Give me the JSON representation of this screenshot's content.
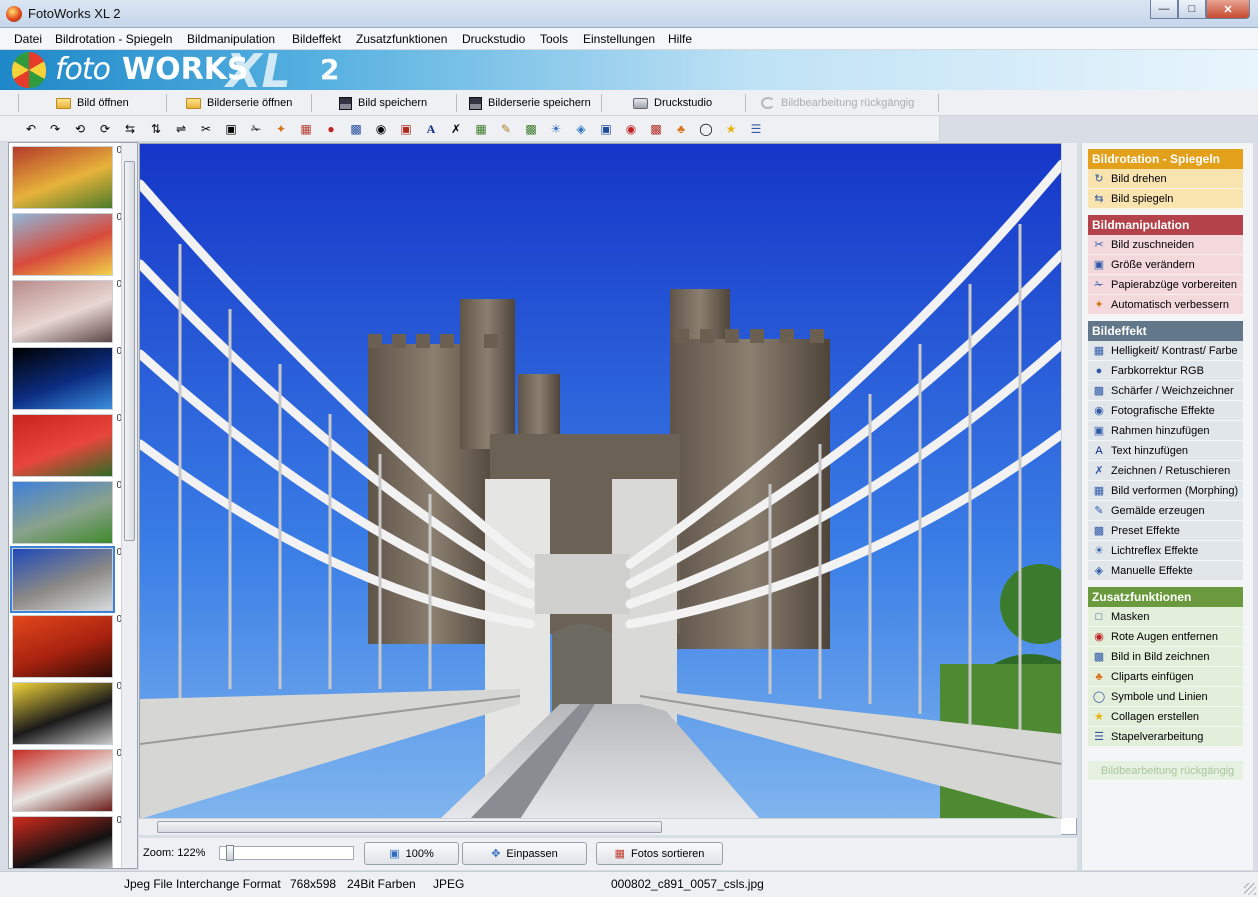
{
  "window": {
    "title": "FotoWorks XL 2"
  },
  "menu": [
    "Datei",
    "Bildrotation - Spiegeln",
    "Bildmanipulation",
    "Bildeffekt",
    "Zusatzfunktionen",
    "Druckstudio",
    "Tools",
    "Einstellungen",
    "Hilfe"
  ],
  "banner": {
    "logo_foto": "foto",
    "logo_works": "WORKS",
    "logo_xl": "XL",
    "logo_version": "2"
  },
  "toolbar": {
    "open_image": "Bild öffnen",
    "open_series": "Bilderserie öffnen",
    "save_image": "Bild speichern",
    "save_series": "Bilderserie speichern",
    "print_studio": "Druckstudio",
    "undo": "Bildbearbeitung rückgängig"
  },
  "tool_icons": [
    "rotate-left-icon",
    "rotate-right-icon",
    "rotate-ccw-icon",
    "rotate-cw-icon",
    "flip-horizontal-icon",
    "flip-vertical-icon",
    "flip-icon",
    "scissors-icon",
    "resize-icon",
    "crop-icon",
    "magic-wand-icon",
    "levels-icon",
    "rgb-icon",
    "sharpen-icon",
    "camera-icon",
    "frame-icon",
    "text-icon",
    "draw-icon",
    "morph-icon",
    "paint-icon",
    "preset-icon",
    "lens-flare-icon",
    "manual-effect-icon",
    "square-icon",
    "red-eye-icon",
    "picture-in-picture-icon",
    "clipart-icon",
    "symbols-icon",
    "star-icon",
    "batch-icon"
  ],
  "thumbnails": [
    {
      "name": "fruits",
      "index": "0",
      "colors": [
        "#b43a2b",
        "#e7b33b",
        "#4c7a2a"
      ]
    },
    {
      "name": "paints",
      "index": "0",
      "colors": [
        "#8fb7d9",
        "#d84a3b",
        "#f1d34a"
      ]
    },
    {
      "name": "conference-room",
      "index": "0",
      "colors": [
        "#b88b8b",
        "#e8d7d2",
        "#5a4545"
      ]
    },
    {
      "name": "earth-moon",
      "index": "0",
      "colors": [
        "#000000",
        "#0b2c80",
        "#3b8ee0"
      ]
    },
    {
      "name": "strawberries",
      "index": "0",
      "colors": [
        "#c8241f",
        "#e8463c",
        "#2c6b25"
      ]
    },
    {
      "name": "castle-blue",
      "index": "0",
      "colors": [
        "#3f7fd8",
        "#8aa28d",
        "#3e8a2c"
      ]
    },
    {
      "name": "bridge-castle",
      "index": "0",
      "colors": [
        "#1f49b8",
        "#8c8a86",
        "#d8dadd"
      ],
      "selected": true
    },
    {
      "name": "airplane-sunset",
      "index": "0",
      "colors": [
        "#e2481c",
        "#a7220f",
        "#2b0c07"
      ]
    },
    {
      "name": "yellow-car",
      "index": "0",
      "colors": [
        "#f0d33a",
        "#1a1a1a",
        "#c9c9c9"
      ]
    },
    {
      "name": "car-interior",
      "index": "0",
      "colors": [
        "#c62b23",
        "#e9e6e3",
        "#6b1b17"
      ]
    },
    {
      "name": "red-car",
      "index": "0",
      "colors": [
        "#d22a1e",
        "#111111",
        "#e9e9e9"
      ]
    }
  ],
  "zoom": {
    "label": "Zoom: 122%",
    "level_fraction": 0.05
  },
  "buttons": {
    "zoom100": "100%",
    "fit": "Einpassen",
    "sort": "Fotos sortieren"
  },
  "side_panel": {
    "sections": [
      {
        "title": "Bildrotation - Spiegeln",
        "header_color": "#e3a01b",
        "item_color": "#f9e4b0",
        "items": [
          {
            "label": "Bild drehen",
            "icon": "rotate-image-icon"
          },
          {
            "label": "Bild spiegeln",
            "icon": "mirror-image-icon"
          }
        ]
      },
      {
        "title": "Bildmanipulation",
        "header_color": "#b3424a",
        "item_color": "#f3d9dc",
        "items": [
          {
            "label": "Bild zuschneiden",
            "icon": "scissors-icon"
          },
          {
            "label": "Größe verändern",
            "icon": "resize-icon"
          },
          {
            "label": "Papierabzüge vorbereiten",
            "icon": "print-crop-icon"
          },
          {
            "label": "Automatisch verbessern",
            "icon": "magic-wand-icon"
          }
        ]
      },
      {
        "title": "Bildeffekt",
        "header_color": "#62778a",
        "item_color": "#e1e6eb",
        "items": [
          {
            "label": "Helligkeit/ Kontrast/ Farbe",
            "icon": "levels-icon"
          },
          {
            "label": "Farbkorrektur RGB",
            "icon": "rgb-icon"
          },
          {
            "label": "Schärfer / Weichzeichner",
            "icon": "sharpen-icon"
          },
          {
            "label": "Fotografische Effekte",
            "icon": "camera-icon"
          },
          {
            "label": "Rahmen hinzufügen",
            "icon": "frame-icon"
          },
          {
            "label": "Text hinzufügen",
            "icon": "text-icon"
          },
          {
            "label": "Zeichnen / Retuschieren",
            "icon": "draw-icon"
          },
          {
            "label": "Bild verformen (Morphing)",
            "icon": "morph-icon"
          },
          {
            "label": "Gemälde erzeugen",
            "icon": "paint-icon"
          },
          {
            "label": "Preset Effekte",
            "icon": "preset-icon"
          },
          {
            "label": "Lichtreflex Effekte",
            "icon": "lens-flare-icon"
          },
          {
            "label": "Manuelle Effekte",
            "icon": "manual-effect-icon"
          }
        ]
      },
      {
        "title": "Zusatzfunktionen",
        "header_color": "#6a9a3d",
        "item_color": "#e3eedb",
        "items": [
          {
            "label": "Masken",
            "icon": "mask-icon"
          },
          {
            "label": "Rote Augen entfernen",
            "icon": "red-eye-icon"
          },
          {
            "label": "Bild in Bild zeichnen",
            "icon": "picture-in-picture-icon"
          },
          {
            "label": "Cliparts einfügen",
            "icon": "clipart-icon"
          },
          {
            "label": "Symbole und Linien",
            "icon": "symbols-icon"
          },
          {
            "label": "Collagen erstellen",
            "icon": "star-icon"
          },
          {
            "label": "Stapelverarbeitung",
            "icon": "batch-icon"
          }
        ]
      }
    ],
    "undo_label": "Bildbearbeitung rückgängig"
  },
  "status": {
    "format": "Jpeg File Interchange Format",
    "dimensions": "768x598",
    "depth": "24Bit Farben",
    "type": "JPEG",
    "filename": "000802_c891_0057_csls.jpg"
  }
}
